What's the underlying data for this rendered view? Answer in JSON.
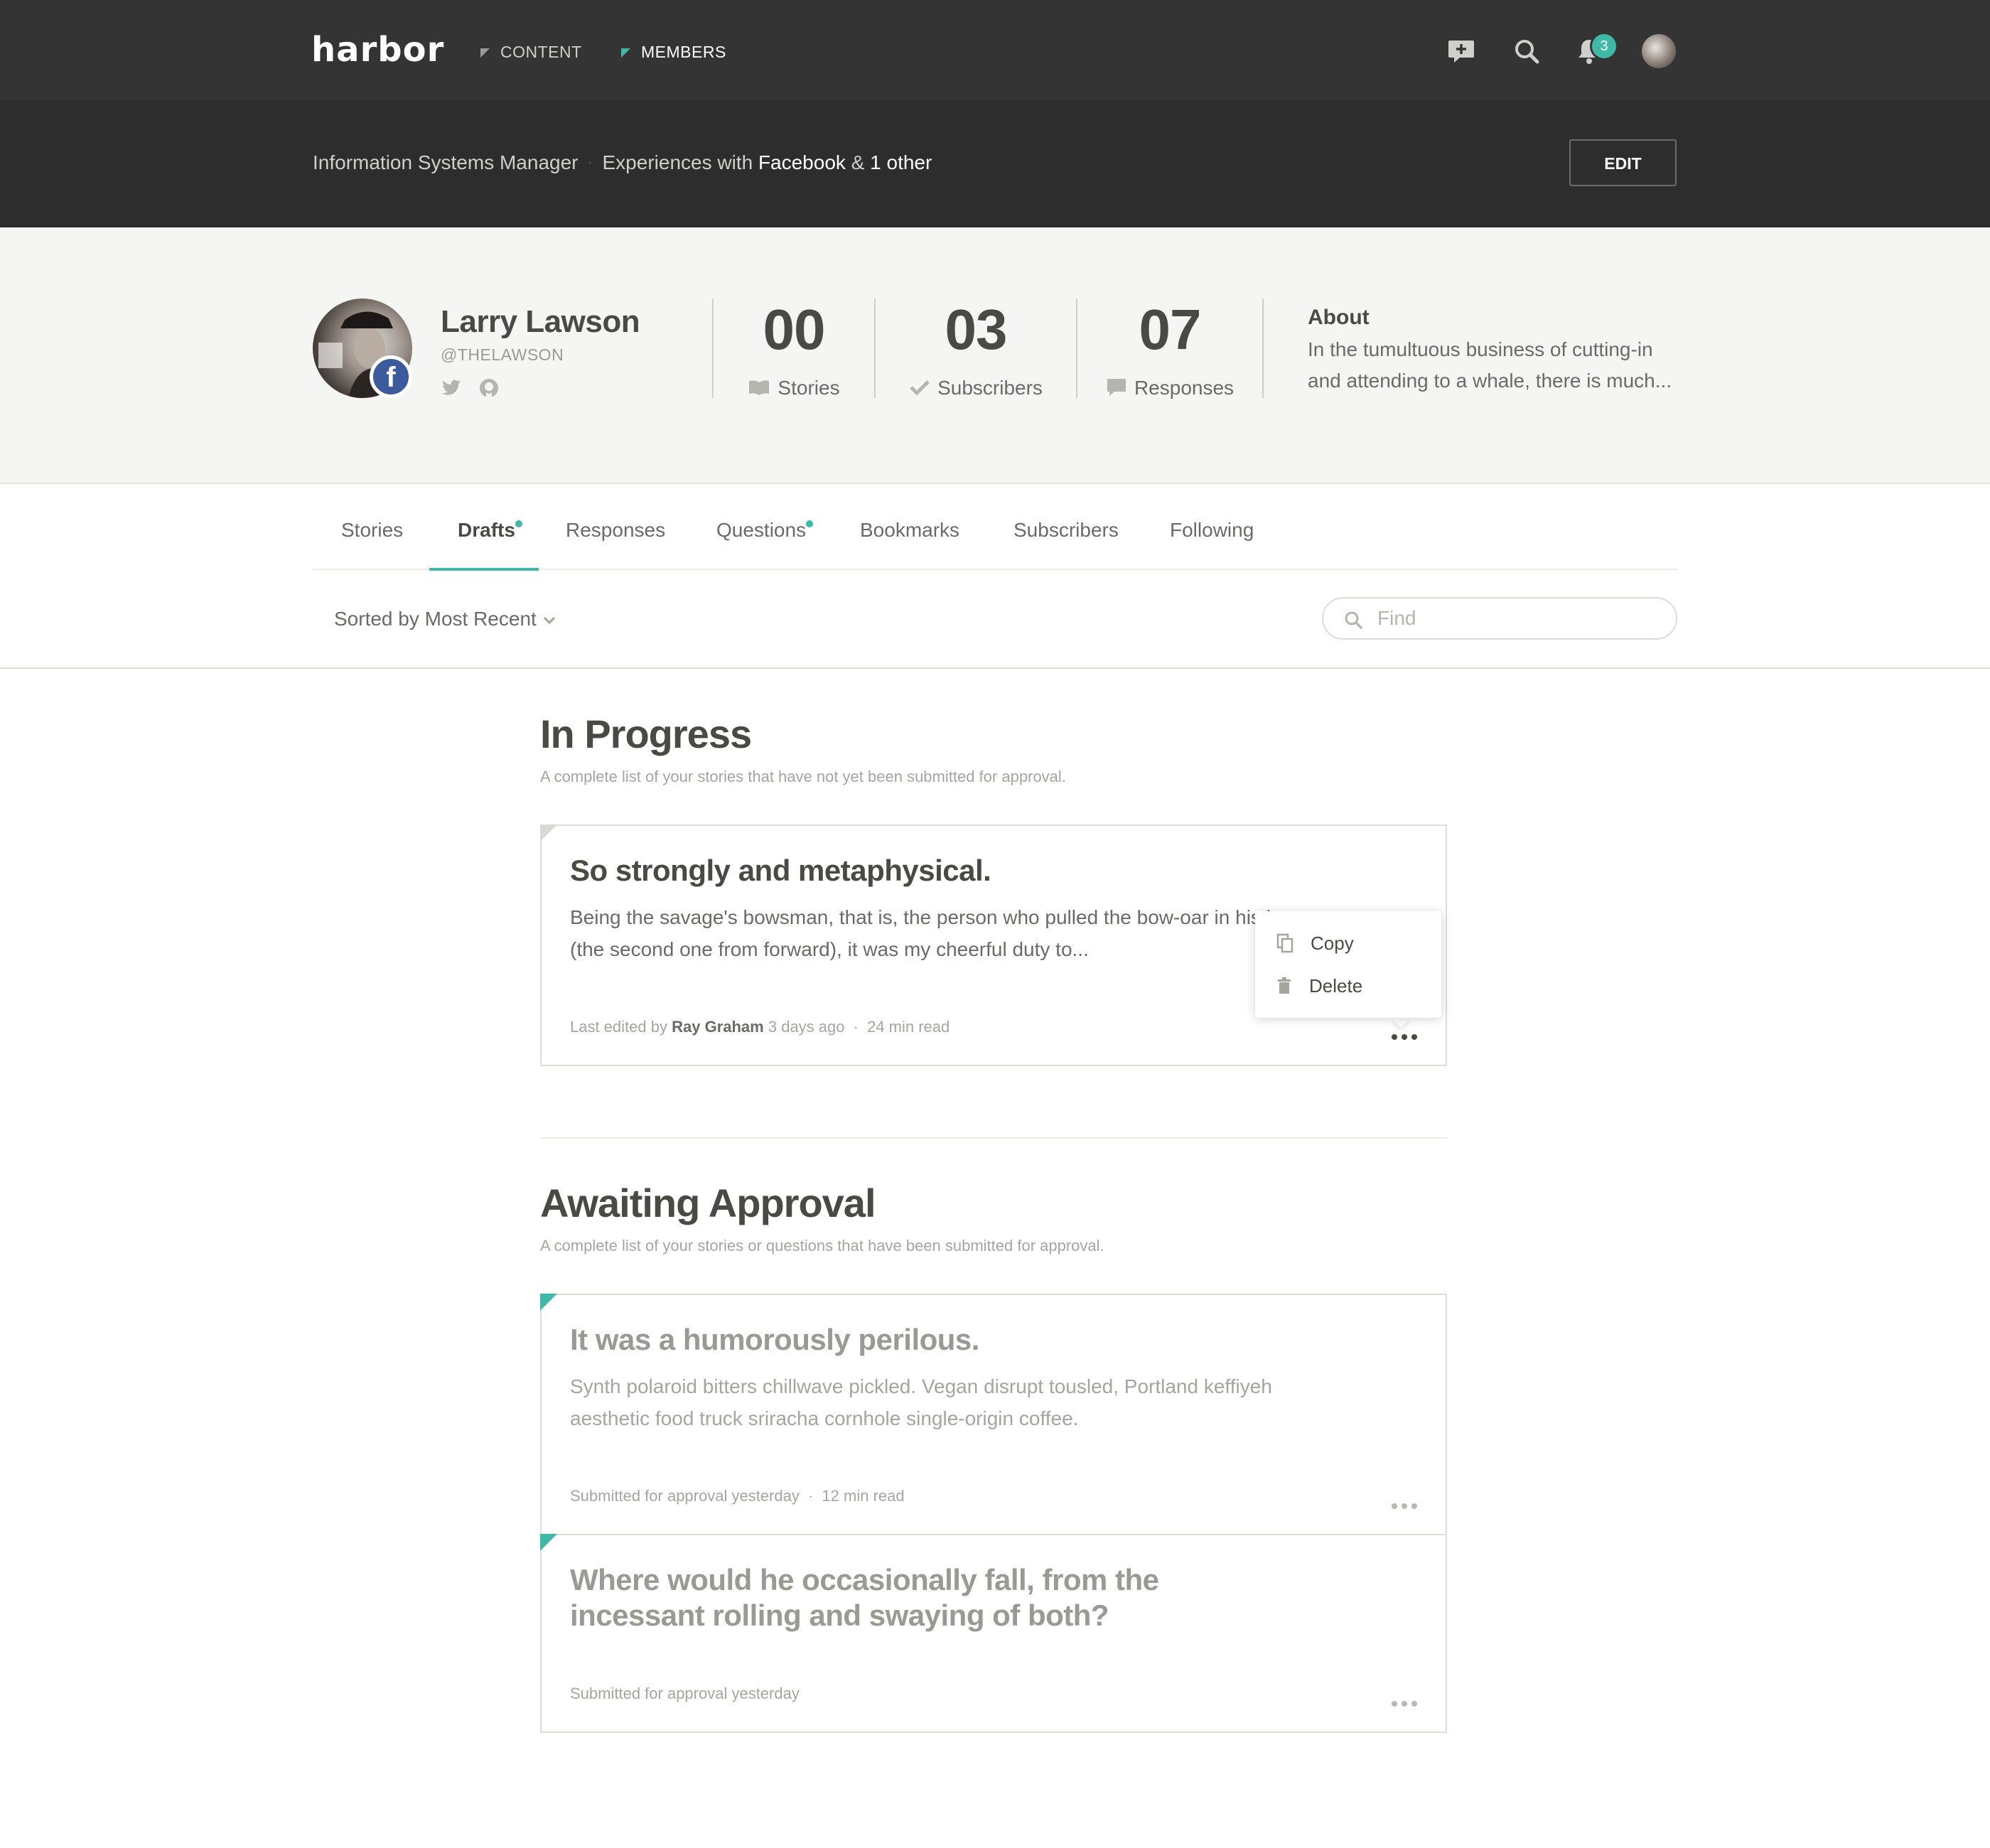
{
  "app": {
    "logo": "harbor",
    "nav": [
      {
        "label": "CONTENT",
        "active": false
      },
      {
        "label": "MEMBERS",
        "active": true
      }
    ],
    "icons": [
      "compose-icon",
      "search-icon",
      "bell-icon",
      "avatar"
    ],
    "notification_count": "3",
    "accent_color": "#3fb8a8"
  },
  "subheader": {
    "role": "Information Systems Manager",
    "experiences_prefix": "Experiences with",
    "experience_link": "Facebook",
    "amp": "&",
    "other_link": "1 other",
    "edit_label": "EDIT"
  },
  "profile": {
    "name": "Larry Lawson",
    "handle": "@THELAWSON",
    "social": [
      "twitter-icon",
      "github-icon"
    ],
    "badge": "f",
    "stats": [
      {
        "value": "00",
        "label": "Stories",
        "icon": "book-icon"
      },
      {
        "value": "03",
        "label": "Subscribers",
        "icon": "check-icon"
      },
      {
        "value": "07",
        "label": "Responses",
        "icon": "comment-icon"
      }
    ],
    "about_title": "About",
    "about_text": "In the tumultuous business of cutting-in and attending to a whale, there is much..."
  },
  "tabs": [
    {
      "label": "Stories",
      "active": false,
      "dot": false
    },
    {
      "label": "Drafts",
      "active": true,
      "dot": true
    },
    {
      "label": "Responses",
      "active": false,
      "dot": false
    },
    {
      "label": "Questions",
      "active": false,
      "dot": true
    },
    {
      "label": "Bookmarks",
      "active": false,
      "dot": false
    },
    {
      "label": "Subscribers",
      "active": false,
      "dot": false
    },
    {
      "label": "Following",
      "active": false,
      "dot": false
    }
  ],
  "toolbar": {
    "sort_label": "Sorted by Most Recent",
    "search_placeholder": "Find"
  },
  "sections": [
    {
      "title": "In Progress",
      "description": "A complete list of your stories that have not yet been submitted for approval.",
      "cards": [
        {
          "title": "So strongly and metaphysical.",
          "body": "Being the savage's bowsman, that is, the person who pulled the bow-oar in his boat (the second one from forward), it was my cheerful duty to...",
          "meta_prefix": "Last edited by",
          "meta_author": "Ray Graham",
          "meta_time": "3 days ago",
          "meta_read": "24 min read"
        }
      ]
    },
    {
      "title": "Awaiting Approval",
      "description": "A complete list of your stories or questions that have been submitted for approval.",
      "cards": [
        {
          "title": "It was a humorously perilous.",
          "body": "Synth polaroid bitters chillwave pickled. Vegan disrupt tousled, Portland keffiyeh aesthetic food truck sriracha cornhole single-origin coffee.",
          "meta_status": "Submitted for approval yesterday",
          "meta_read": "12 min read"
        },
        {
          "title": "Where would he occasionally fall, from the incessant rolling and swaying of both?",
          "meta_status": "Submitted for approval yesterday"
        }
      ]
    }
  ],
  "context_menu": {
    "items": [
      {
        "label": "Copy",
        "icon": "copy-icon"
      },
      {
        "label": "Delete",
        "icon": "trash-icon"
      }
    ]
  },
  "separator": "·"
}
